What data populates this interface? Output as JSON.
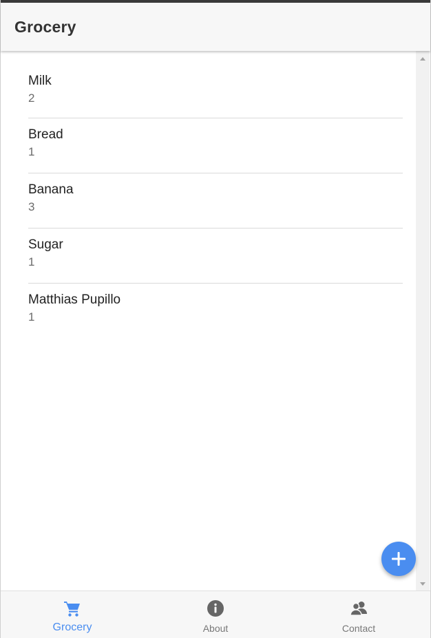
{
  "header": {
    "title": "Grocery"
  },
  "items": [
    {
      "name": "Milk",
      "qty": "2"
    },
    {
      "name": "Bread",
      "qty": "1"
    },
    {
      "name": "Banana",
      "qty": "3"
    },
    {
      "name": "Sugar",
      "qty": "1"
    },
    {
      "name": "Matthias Pupillo",
      "qty": "1"
    }
  ],
  "fab": {
    "icon": "plus-icon"
  },
  "nav": {
    "tabs": [
      {
        "label": "Grocery",
        "icon": "cart-icon",
        "active": true
      },
      {
        "label": "About",
        "icon": "info-icon",
        "active": false
      },
      {
        "label": "Contact",
        "icon": "contacts-icon",
        "active": false
      }
    ]
  },
  "colors": {
    "accent": "#4a8df0",
    "header_bg": "#f7f7f7",
    "inactive": "#777777"
  }
}
